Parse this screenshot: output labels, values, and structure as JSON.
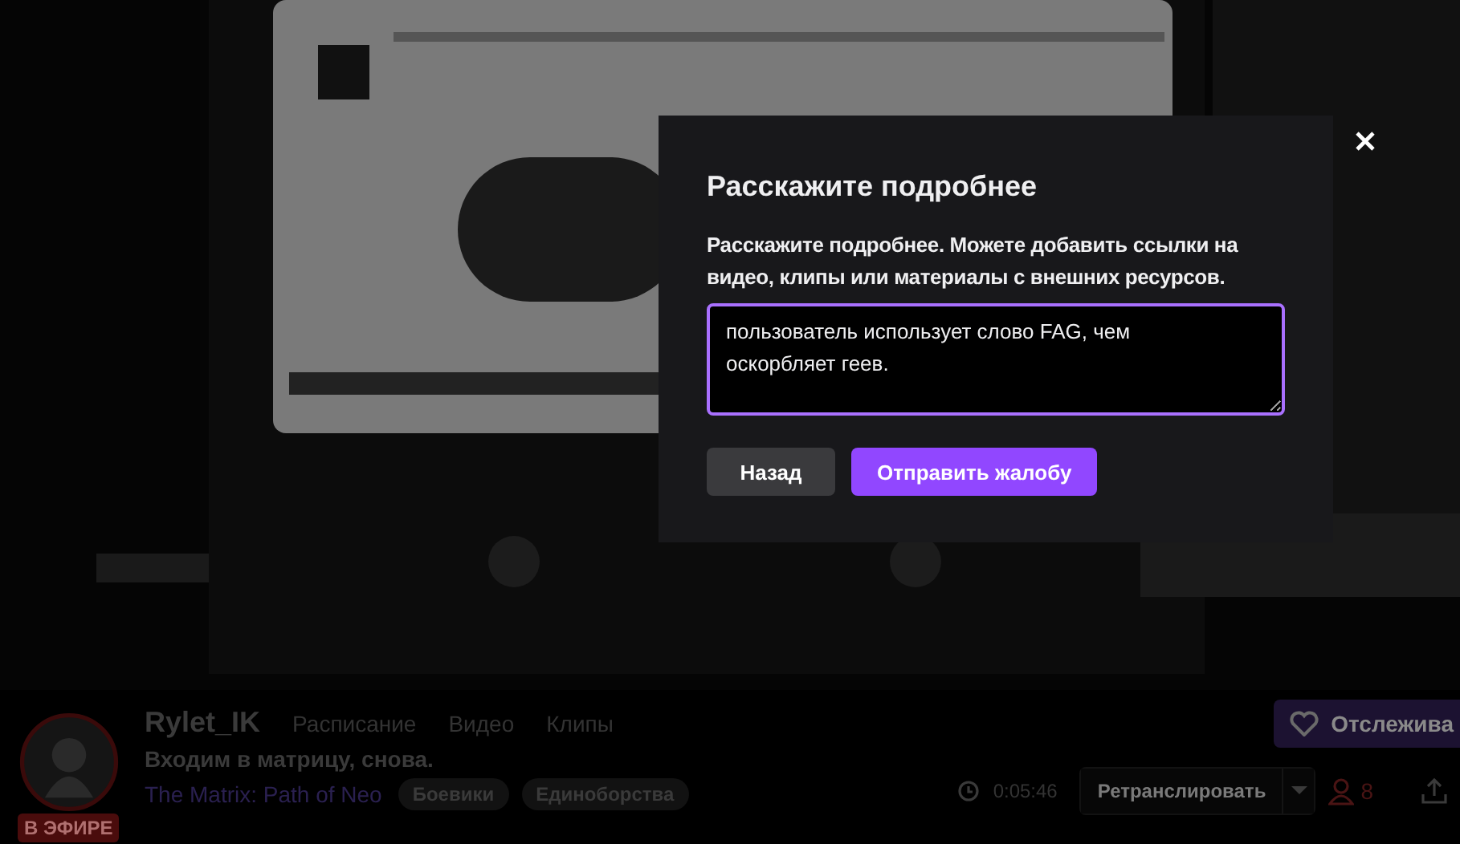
{
  "modal": {
    "title": "Расскажите подробнее",
    "prompt": "Расскажите подробнее. Можете добавить ссылки на видео, клипы или материалы с внешних ресурсов.",
    "textarea": {
      "value": "пользователь использует слово FAG, чем оскорбляет геев."
    },
    "buttons": [
      {
        "label": "Назад",
        "kind": "secondary"
      },
      {
        "label": "Отправить жалобу",
        "kind": "primary"
      }
    ]
  },
  "channel": {
    "name": "Rylet_IK",
    "live_badge": "В ЭФИРЕ",
    "nav": [
      "Расписание",
      "Видео",
      "Клипы"
    ],
    "stream_title": "Входим в матрицу, снова.",
    "game": "The Matrix: Path of Neo",
    "tags": [
      "Боевики",
      "Единоборства"
    ],
    "follow_button": "Отслежива",
    "uptime": "0:05:46",
    "rebroadcast_button": "Ретранслировать",
    "viewers": "8"
  }
}
